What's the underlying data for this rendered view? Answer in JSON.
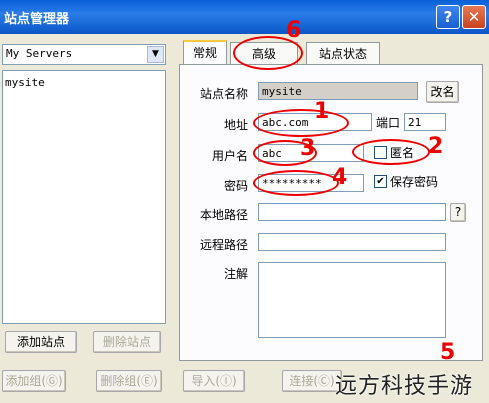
{
  "window": {
    "title": "站点管理器",
    "help_glyph": "?",
    "close_glyph": "✕"
  },
  "sites": {
    "dropdown_value": "My Servers",
    "items": [
      "mysite"
    ]
  },
  "tabs": [
    "常规",
    "高级",
    "站点状态"
  ],
  "form": {
    "site_name_label": "站点名称",
    "site_name_value": "mysite",
    "rename_button": "改名",
    "address_label": "地址",
    "address_value": "abc.com",
    "port_label": "端口",
    "port_value": "21",
    "username_label": "用户名",
    "username_value": "abc",
    "anonymous_label": "匿名",
    "password_label": "密码",
    "password_value": "*********",
    "save_password_label": "保存密码",
    "local_path_label": "本地路径",
    "local_path_button": "?",
    "remote_path_label": "远程路径",
    "note_label": "注解"
  },
  "buttons": {
    "add_site": "添加站点",
    "delete_site": "删除站点",
    "add_group": "添加组(Ⓖ)",
    "delete_group": "删除组(Ⓔ)",
    "import": "导入(Ⓘ)",
    "connect": "连接(Ⓒ)"
  },
  "annotations": {
    "n1": "1",
    "n2": "2",
    "n3": "3",
    "n4": "4",
    "n5": "5",
    "n6": "6"
  },
  "watermark": "远方科技手游"
}
